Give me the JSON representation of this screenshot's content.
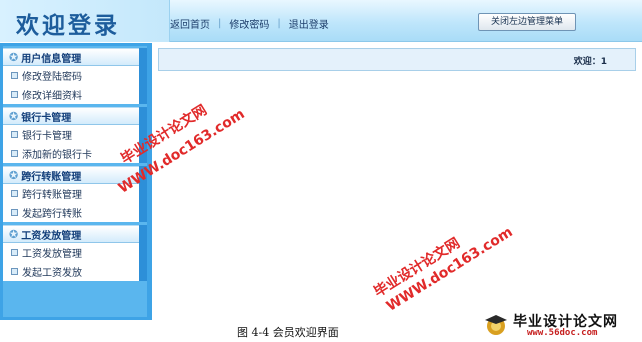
{
  "header": {
    "title": "欢迎登录",
    "nav": [
      "返回首页",
      "修改密码",
      "退出登录"
    ],
    "nav_separator": "|",
    "close_button": "关闭左边管理菜单"
  },
  "sidebar": {
    "groups": [
      {
        "title": "用户信息管理",
        "items": [
          "修改登陆密码",
          "修改详细资料"
        ]
      },
      {
        "title": "银行卡管理",
        "items": [
          "银行卡管理",
          "添加新的银行卡"
        ]
      },
      {
        "title": "跨行转账管理",
        "items": [
          "跨行转账管理",
          "发起跨行转账"
        ]
      },
      {
        "title": "工资发放管理",
        "items": [
          "工资发放管理",
          "发起工资发放"
        ]
      }
    ]
  },
  "main": {
    "welcome": "欢迎：1"
  },
  "watermarks": {
    "cn": "毕业设计论文网",
    "url": "WWW.doc163.com"
  },
  "caption": "图 4-4   会员欢迎界面",
  "logo": {
    "name": "毕业设计论文网",
    "url": "www.56doc.com"
  },
  "colors": {
    "sidebar": "#3ea3e6",
    "header": "#bfe6fb",
    "watermark": "#e12a2a"
  }
}
